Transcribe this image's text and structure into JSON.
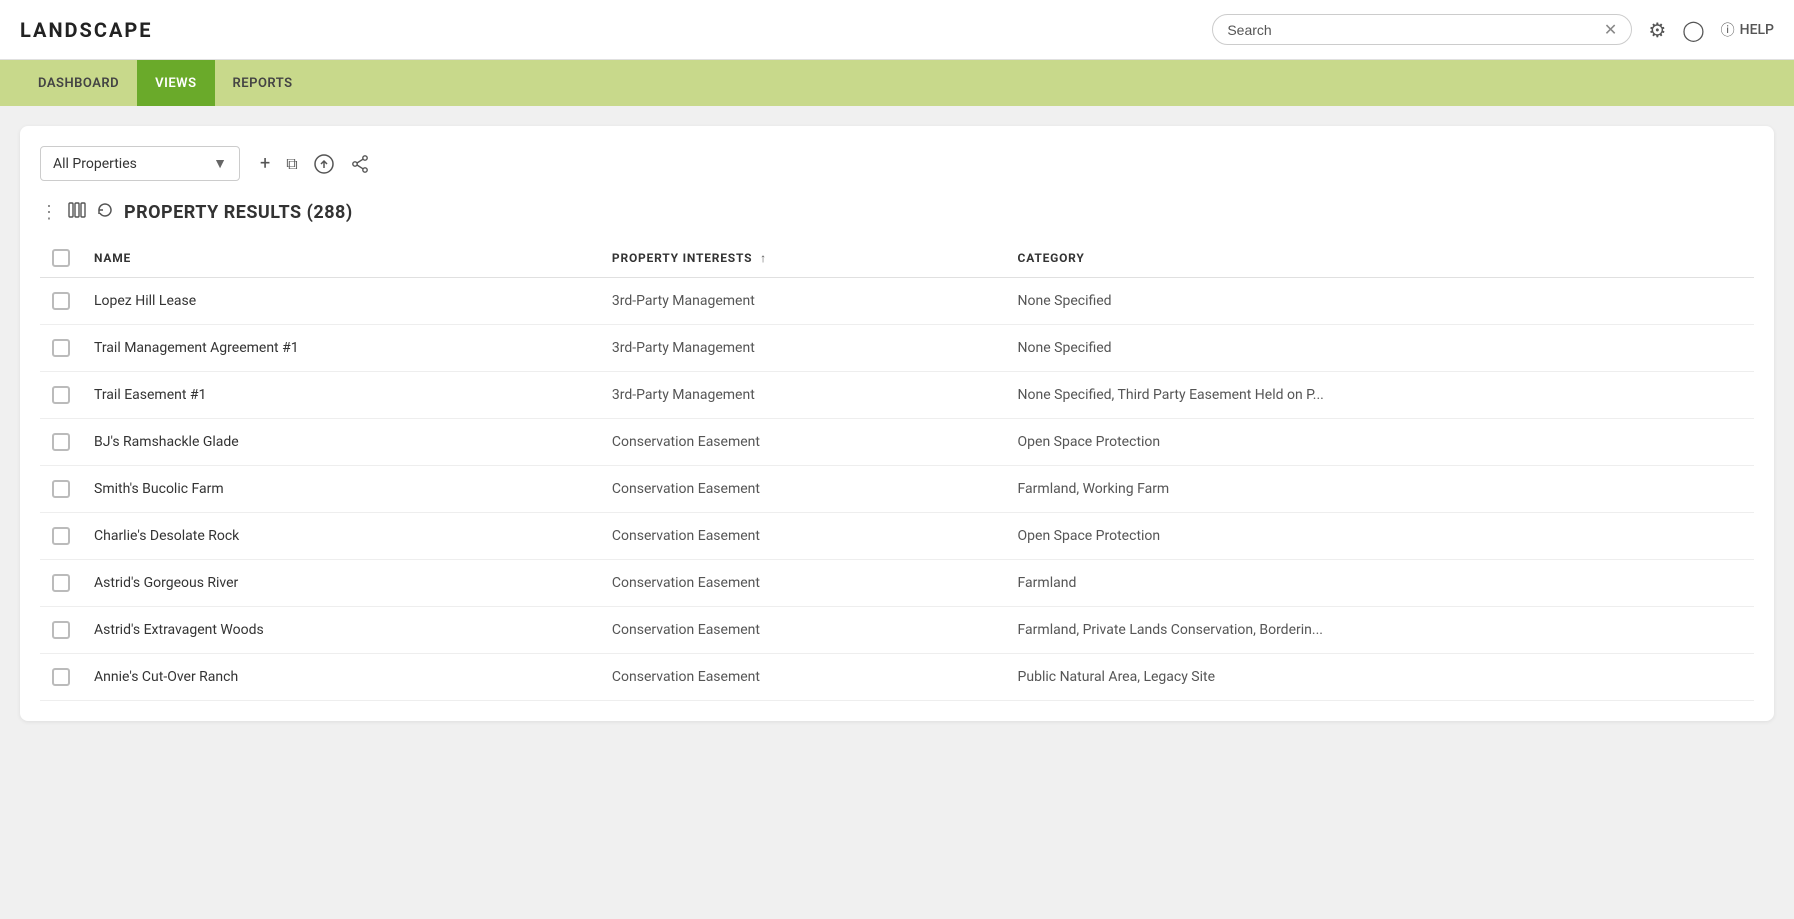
{
  "app": {
    "logo": "LANDSCAPE"
  },
  "header": {
    "search_placeholder": "Search",
    "search_value": "Search",
    "help_label": "HELP"
  },
  "nav": {
    "items": [
      {
        "label": "DASHBOARD",
        "active": false
      },
      {
        "label": "VIEWS",
        "active": true
      },
      {
        "label": "REPORTS",
        "active": false
      }
    ]
  },
  "view_selector": {
    "label": "All Properties"
  },
  "toolbar_actions": {
    "add_icon": "+",
    "copy_icon": "⧉",
    "upload_icon": "⬆",
    "share_icon": "⤢"
  },
  "results": {
    "title": "PROPERTY RESULTS (288)"
  },
  "table": {
    "columns": [
      {
        "label": "NAME",
        "sortable": false
      },
      {
        "label": "PROPERTY INTERESTS",
        "sortable": true
      },
      {
        "label": "CATEGORY",
        "sortable": false
      }
    ],
    "rows": [
      {
        "name": "Lopez Hill Lease",
        "property_interests": "3rd-Party Management",
        "category": "None Specified"
      },
      {
        "name": "Trail Management Agreement #1",
        "property_interests": "3rd-Party Management",
        "category": "None Specified"
      },
      {
        "name": "Trail Easement #1",
        "property_interests": "3rd-Party Management",
        "category": "None Specified, Third Party Easement Held on P..."
      },
      {
        "name": "BJ's Ramshackle Glade",
        "property_interests": "Conservation Easement",
        "category": "Open Space Protection"
      },
      {
        "name": "Smith's Bucolic Farm",
        "property_interests": "Conservation Easement",
        "category": "Farmland, Working Farm"
      },
      {
        "name": "Charlie's Desolate Rock",
        "property_interests": "Conservation Easement",
        "category": "Open Space Protection"
      },
      {
        "name": "Astrid's Gorgeous River",
        "property_interests": "Conservation Easement",
        "category": "Farmland"
      },
      {
        "name": "Astrid's Extravagent Woods",
        "property_interests": "Conservation Easement",
        "category": "Farmland, Private Lands Conservation, Borderin..."
      },
      {
        "name": "Annie's Cut-Over Ranch",
        "property_interests": "Conservation Easement",
        "category": "Public Natural Area, Legacy Site"
      }
    ]
  }
}
